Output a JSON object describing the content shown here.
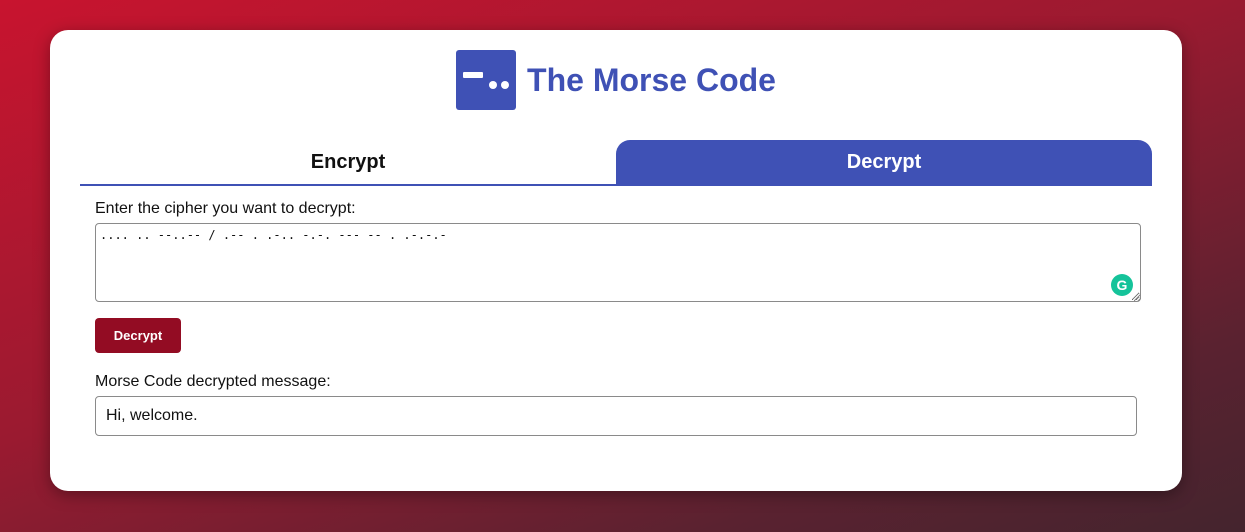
{
  "header": {
    "title": "The Morse Code",
    "logo_icon": "morse-dash-dot-icon",
    "accent_color": "#3f51b5"
  },
  "tabs": [
    {
      "label": "Encrypt",
      "active": false
    },
    {
      "label": "Decrypt",
      "active": true
    }
  ],
  "decrypt": {
    "cipher_label": "Enter the cipher you want to decrypt:",
    "cipher_value": ".... .. --..-- / .-- . .-.. -.-. --- -- . .-.-.-",
    "button_label": "Decrypt",
    "button_color": "#930c23",
    "result_label": "Morse Code decrypted message:",
    "result_value": "Hi, welcome."
  },
  "extensions": {
    "grammar_icon": "grammarly-icon",
    "grammar_icon_glyph": "G"
  }
}
